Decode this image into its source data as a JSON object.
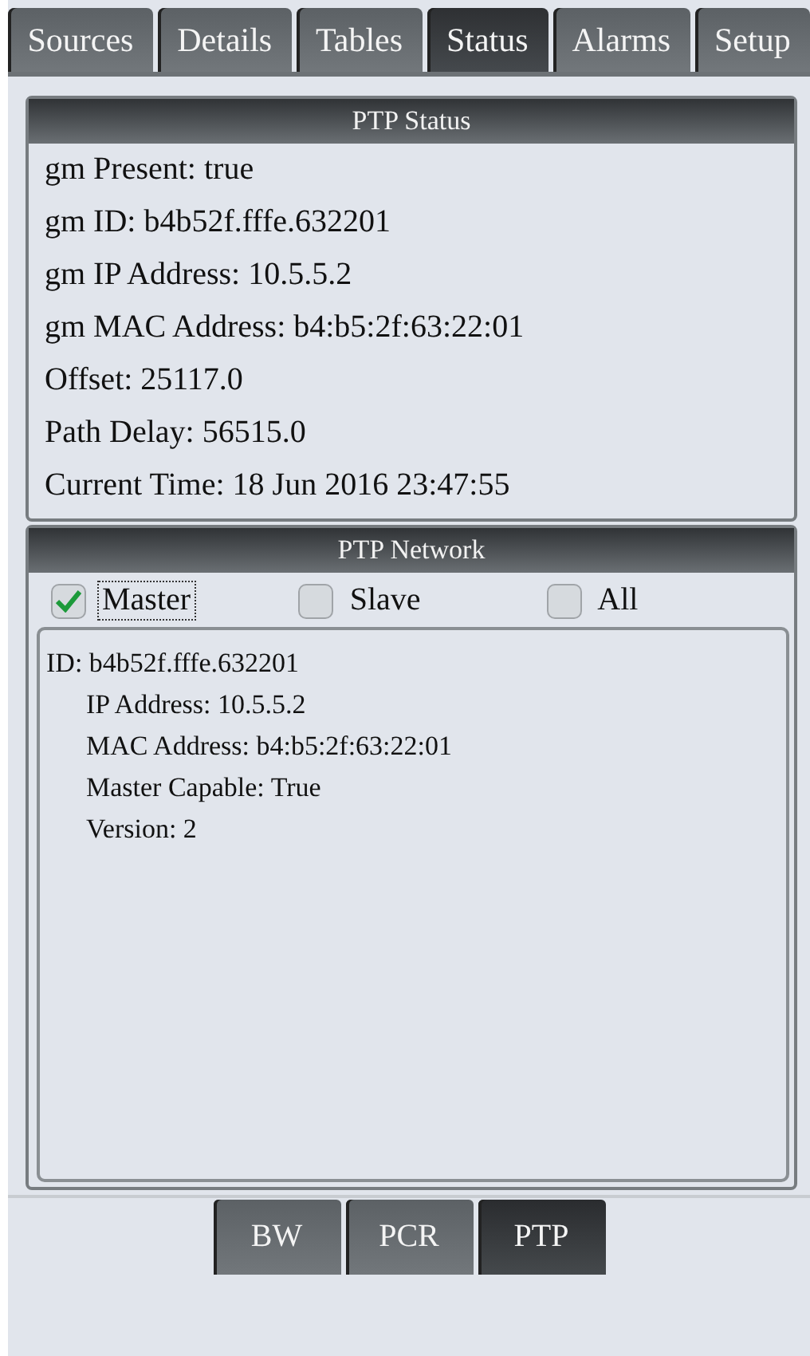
{
  "tabs": [
    {
      "label": "Sources",
      "selected": false
    },
    {
      "label": "Details",
      "selected": false
    },
    {
      "label": "Tables",
      "selected": false
    },
    {
      "label": "Status",
      "selected": true
    },
    {
      "label": "Alarms",
      "selected": false
    },
    {
      "label": "Setup",
      "selected": false
    }
  ],
  "ptp_status": {
    "title": "PTP Status",
    "lines": [
      "gm Present: true",
      "gm ID: b4b52f.fffe.632201",
      "gm IP Address: 10.5.5.2",
      "gm MAC Address: b4:b5:2f:63:22:01",
      "Offset: 25117.0",
      "Path Delay: 56515.0",
      "Current Time: 18 Jun 2016 23:47:55"
    ]
  },
  "ptp_network": {
    "title": "PTP Network",
    "filters": [
      {
        "label": "Master",
        "checked": true,
        "focused": true
      },
      {
        "label": "Slave",
        "checked": false,
        "focused": false
      },
      {
        "label": "All",
        "checked": false,
        "focused": false
      }
    ],
    "entries": [
      {
        "text": "ID: b4b52f.fffe.632201",
        "children": [
          {
            "text": "IP Address: 10.5.5.2"
          },
          {
            "text": "MAC Address: b4:b5:2f:63:22:01"
          },
          {
            "text": "Master Capable: True"
          },
          {
            "text": "Version: 2"
          }
        ]
      }
    ]
  },
  "bottom_tabs": [
    {
      "label": "BW",
      "selected": false
    },
    {
      "label": "PCR",
      "selected": false
    },
    {
      "label": "PTP",
      "selected": true
    }
  ]
}
